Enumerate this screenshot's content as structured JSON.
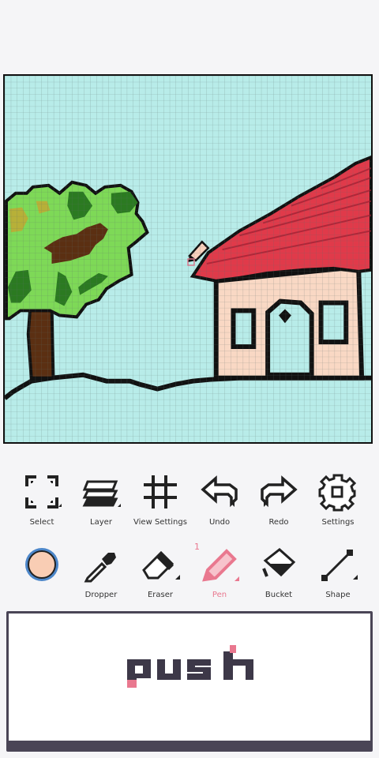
{
  "canvas": {
    "background": "#b8ece9",
    "grid_color": "#6b7d7c"
  },
  "toolbar_top": [
    {
      "label": "Select",
      "icon": "select-icon"
    },
    {
      "label": "Layer",
      "icon": "layers-icon"
    },
    {
      "label": "View Settings",
      "icon": "grid-icon"
    },
    {
      "label": "Undo",
      "icon": "undo-arrow-icon"
    },
    {
      "label": "Redo",
      "icon": "redo-arrow-icon"
    },
    {
      "label": "Settings",
      "icon": "gear-icon"
    }
  ],
  "toolbar_bottom": {
    "color_swatch": {
      "color": "#f9cdb4",
      "ring": "#4c86c9"
    },
    "tools": [
      {
        "label": "Dropper",
        "icon": "dropper-icon"
      },
      {
        "label": "Eraser",
        "icon": "eraser-icon"
      },
      {
        "label": "Pen",
        "icon": "pen-icon",
        "active": true,
        "size": "1"
      },
      {
        "label": "Bucket",
        "icon": "bucket-icon"
      },
      {
        "label": "Shape",
        "icon": "line-shape-icon"
      }
    ]
  },
  "push_button": {
    "label": "push",
    "text_color": "#3d3848",
    "accent_color": "#e9788f"
  },
  "colors": {
    "accent": "#e9788f",
    "roof": "#e03a4a",
    "house_wall": "#f9d8c4",
    "window": "#b8ece9",
    "tree_light": "#7ed957",
    "tree_dark": "#2b7a21",
    "trunk": "#5b2f12"
  }
}
